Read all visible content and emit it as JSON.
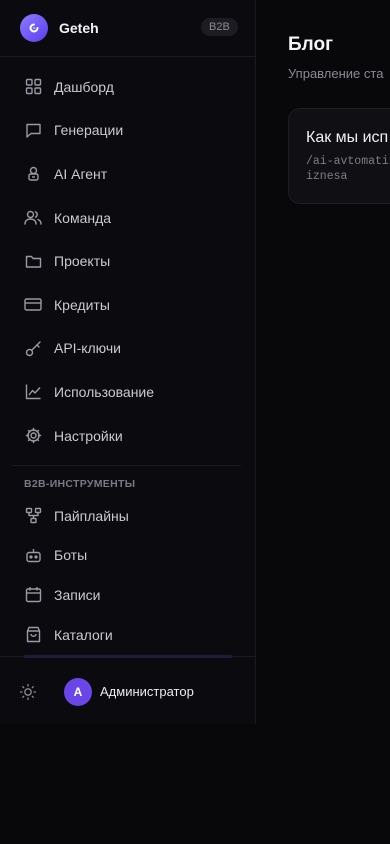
{
  "brand": {
    "name": "Geteh",
    "badge": "B2B"
  },
  "nav": [
    {
      "id": "dashboard",
      "label": "Дашборд",
      "icon": "grid-icon"
    },
    {
      "id": "generations",
      "label": "Генерации",
      "icon": "message-icon"
    },
    {
      "id": "ai-agent",
      "label": "AI Агент",
      "icon": "agent-icon"
    },
    {
      "id": "team",
      "label": "Команда",
      "icon": "users-icon"
    },
    {
      "id": "projects",
      "label": "Проекты",
      "icon": "folder-icon"
    },
    {
      "id": "credits",
      "label": "Кредиты",
      "icon": "credit-card-icon"
    },
    {
      "id": "api-keys",
      "label": "API-ключи",
      "icon": "key-icon"
    },
    {
      "id": "usage",
      "label": "Использование",
      "icon": "chart-icon"
    },
    {
      "id": "settings",
      "label": "Настройки",
      "icon": "gear-icon"
    }
  ],
  "b2b_section": {
    "title": "B2B-ИНСТРУМЕНТЫ",
    "items": [
      {
        "id": "pipelines",
        "label": "Пайплайны",
        "icon": "pipeline-icon"
      },
      {
        "id": "bots",
        "label": "Боты",
        "icon": "bot-icon"
      },
      {
        "id": "records",
        "label": "Записи",
        "icon": "calendar-icon"
      },
      {
        "id": "catalogs",
        "label": "Каталоги",
        "icon": "shopping-bag-icon"
      }
    ]
  },
  "footer": {
    "avatar_initial": "A",
    "user_name": "Администратор",
    "theme_icon": "sun-icon"
  },
  "main": {
    "title": "Блог",
    "subtitle": "Управление ста",
    "card": {
      "title": "Как мы исп",
      "slug": "/ai-avtomatibiznesa"
    }
  }
}
